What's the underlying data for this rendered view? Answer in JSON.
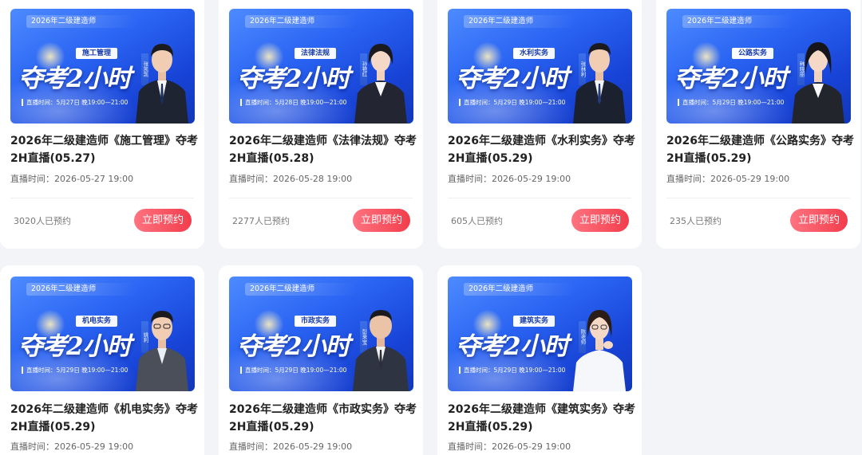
{
  "banner_common": {
    "top_tag": "2026年二级建造师",
    "headline": "夺考2小时"
  },
  "cards": [
    {
      "subject": "施工管理",
      "live_line": "直播时间：5月27日 晚19:00—21:00",
      "teacher": "张凯凯",
      "title": "2026年二级建造师《施工管理》夺考2H直播(05.27)",
      "time": "直播时间：2026-05-27 19:00",
      "count": "3020人已预约",
      "button": "立即预约"
    },
    {
      "subject": "法律法规",
      "live_line": "直播时间：5月28日 晚19:00—21:00",
      "teacher": "孙艳红",
      "title": "2026年二级建造师《法律法规》夺考2H直播(05.28)",
      "time": "直播时间：2026-05-28 19:00",
      "count": "2277人已预约",
      "button": "立即预约"
    },
    {
      "subject": "水利实务",
      "live_line": "直播时间：5月29日 晚19:00—21:00",
      "teacher": "张林利",
      "title": "2026年二级建造师《水利实务》夺考2H直播(05.29)",
      "time": "直播时间：2026-05-29 19:00",
      "count": "605人已预约",
      "button": "立即预约"
    },
    {
      "subject": "公路实务",
      "live_line": "直播时间：5月29日 晚19:00—21:00",
      "teacher": "韩晓丽",
      "title": "2026年二级建造师《公路实务》夺考2H直播(05.29)",
      "time": "直播时间：2026-05-29 19:00",
      "count": "235人已预约",
      "button": "立即预约"
    },
    {
      "subject": "机电实务",
      "live_line": "直播时间：5月29日 晚19:00—21:00",
      "teacher": "姚利",
      "title": "2026年二级建造师《机电实务》夺考2H直播(05.29)",
      "time": "直播时间：2026-05-29 19:00",
      "count": "",
      "button": ""
    },
    {
      "subject": "市政实务",
      "live_line": "直播时间：5月29日 晚19:00—21:00",
      "teacher": "彭来宝",
      "title": "2026年二级建造师《市政实务》夺考2H直播(05.29)",
      "time": "直播时间：2026-05-29 19:00",
      "count": "",
      "button": ""
    },
    {
      "subject": "建筑实务",
      "live_line": "直播时间：5月29日 晚19:00—21:00",
      "teacher": "陈老师",
      "title": "2026年二级建造师《建筑实务》夺考2H直播(05.29)",
      "time": "直播时间：2026-05-29 19:00",
      "count": "",
      "button": ""
    }
  ],
  "colors": {
    "button_start": "#ff7380",
    "button_end": "#f23d4c",
    "banner_blue": "#2a64f3",
    "page_bg": "#f3f4f7"
  }
}
